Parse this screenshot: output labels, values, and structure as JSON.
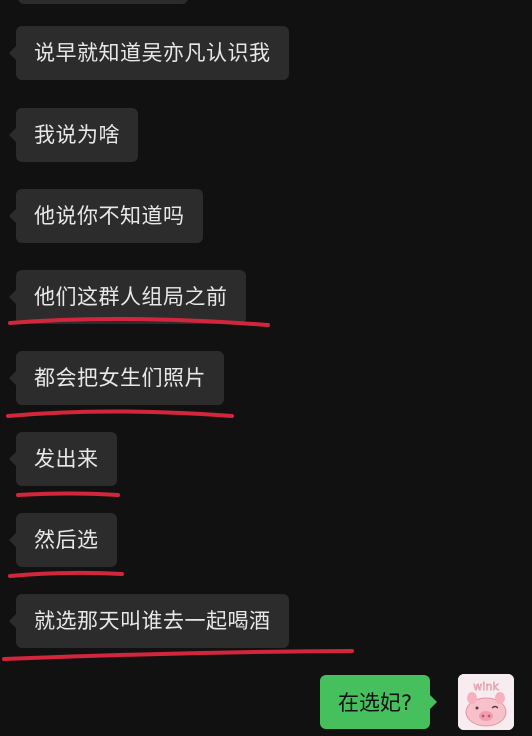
{
  "chat": {
    "messages": [
      "说早就知道吴亦凡认识我",
      "我说为啥",
      "他说你不知道吗",
      "他们这群人组局之前",
      "都会把女生们照片",
      "发出来",
      "然后选",
      "就选那天叫谁去一起喝酒"
    ],
    "sent_message": "在选妃?",
    "avatar_text": "wink"
  },
  "colors": {
    "background": "#111111",
    "received_bubble": "#2c2c2c",
    "sent_bubble": "#45c05c",
    "underline": "#d3263c"
  }
}
